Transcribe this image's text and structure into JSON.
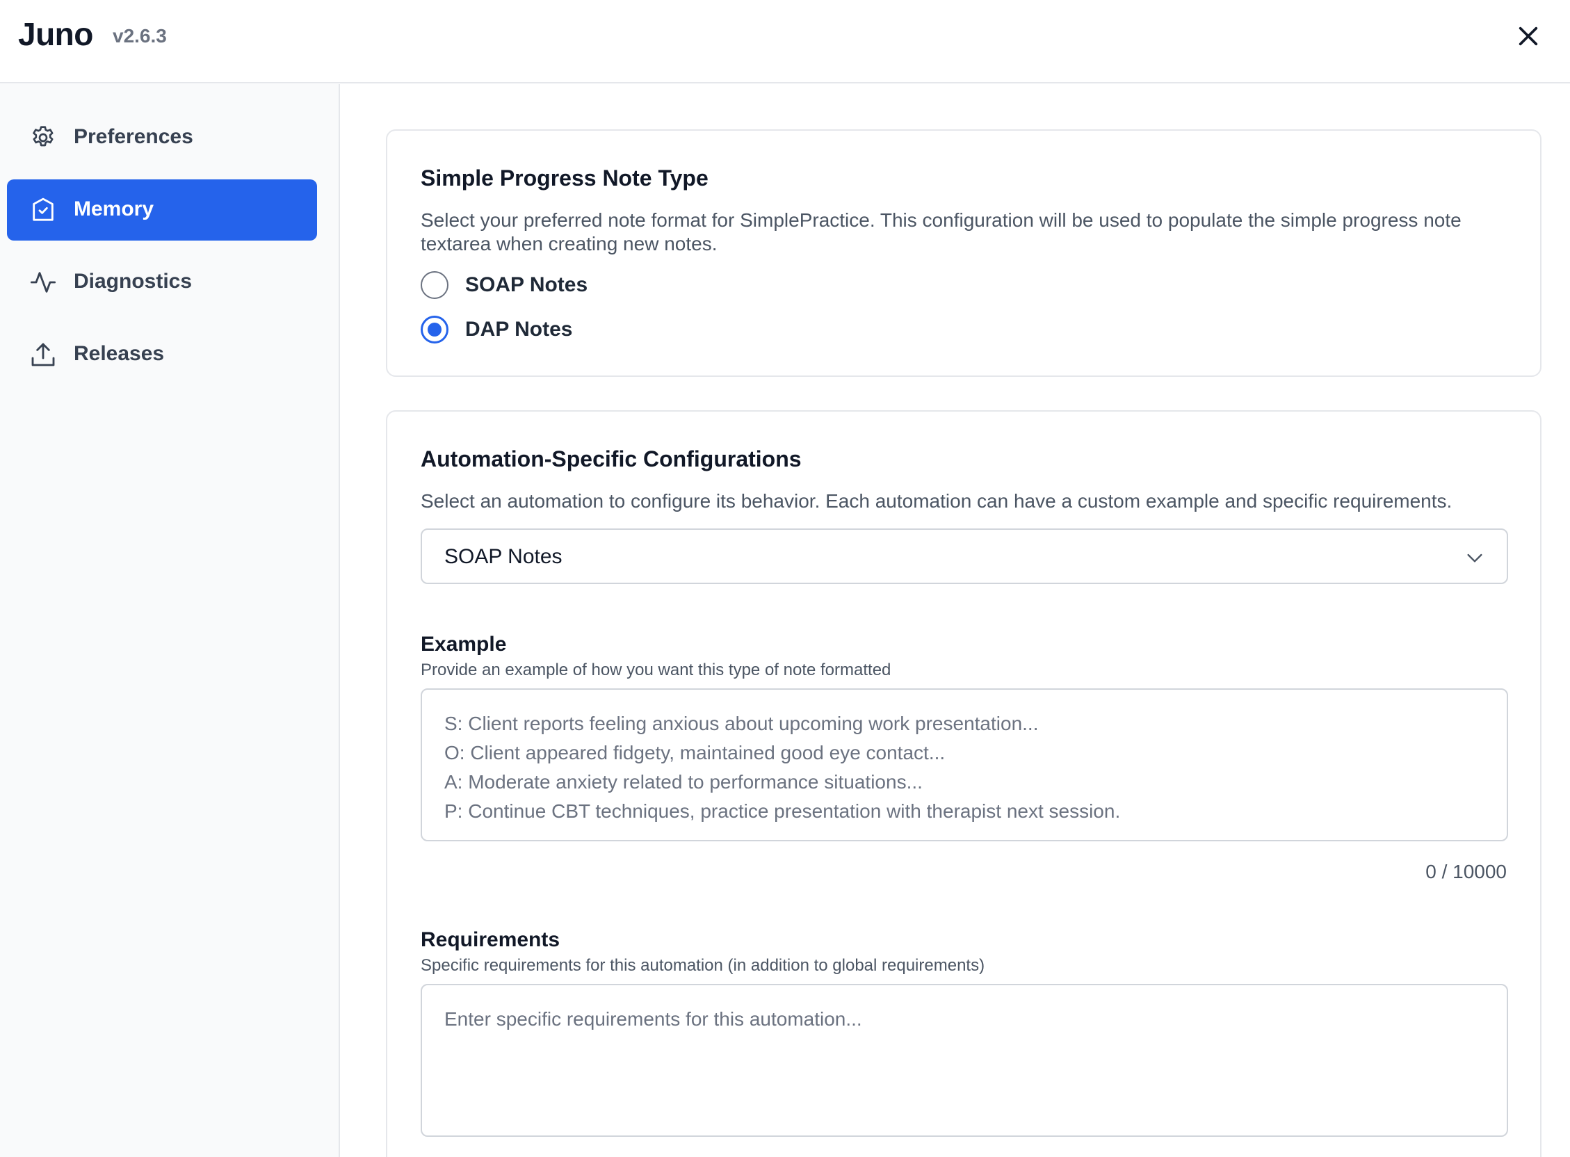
{
  "app": {
    "title": "Juno",
    "version": "v2.6.3"
  },
  "sidebar": {
    "items": [
      {
        "label": "Preferences",
        "icon": "gear-icon",
        "active": false
      },
      {
        "label": "Memory",
        "icon": "shield-check-icon",
        "active": true
      },
      {
        "label": "Diagnostics",
        "icon": "activity-icon",
        "active": false
      },
      {
        "label": "Releases",
        "icon": "upload-icon",
        "active": false
      }
    ]
  },
  "note_type_card": {
    "title": "Simple Progress Note Type",
    "description": "Select your preferred note format for SimplePractice. This configuration will be used to populate the simple progress note textarea when creating new notes.",
    "options": [
      {
        "label": "SOAP Notes",
        "checked": false
      },
      {
        "label": "DAP Notes",
        "checked": true
      }
    ]
  },
  "automation_card": {
    "title": "Automation-Specific Configurations",
    "description": "Select an automation to configure its behavior. Each automation can have a custom example and specific requirements.",
    "selected_automation": "SOAP Notes",
    "example": {
      "label": "Example",
      "help": "Provide an example of how you want this type of note formatted",
      "placeholder_lines": [
        "S: Client reports feeling anxious about upcoming work presentation...",
        "O: Client appeared fidgety, maintained good eye contact...",
        "A: Moderate anxiety related to performance situations...",
        "P: Continue CBT techniques, practice presentation with therapist next session."
      ],
      "counter": "0 / 10000"
    },
    "requirements": {
      "label": "Requirements",
      "help": "Specific requirements for this automation (in addition to global requirements)",
      "placeholder": "Enter specific requirements for this automation..."
    }
  },
  "colors": {
    "accent": "#2563eb",
    "border": "#e5e7eb",
    "sidebar_bg": "#f9fafb"
  }
}
